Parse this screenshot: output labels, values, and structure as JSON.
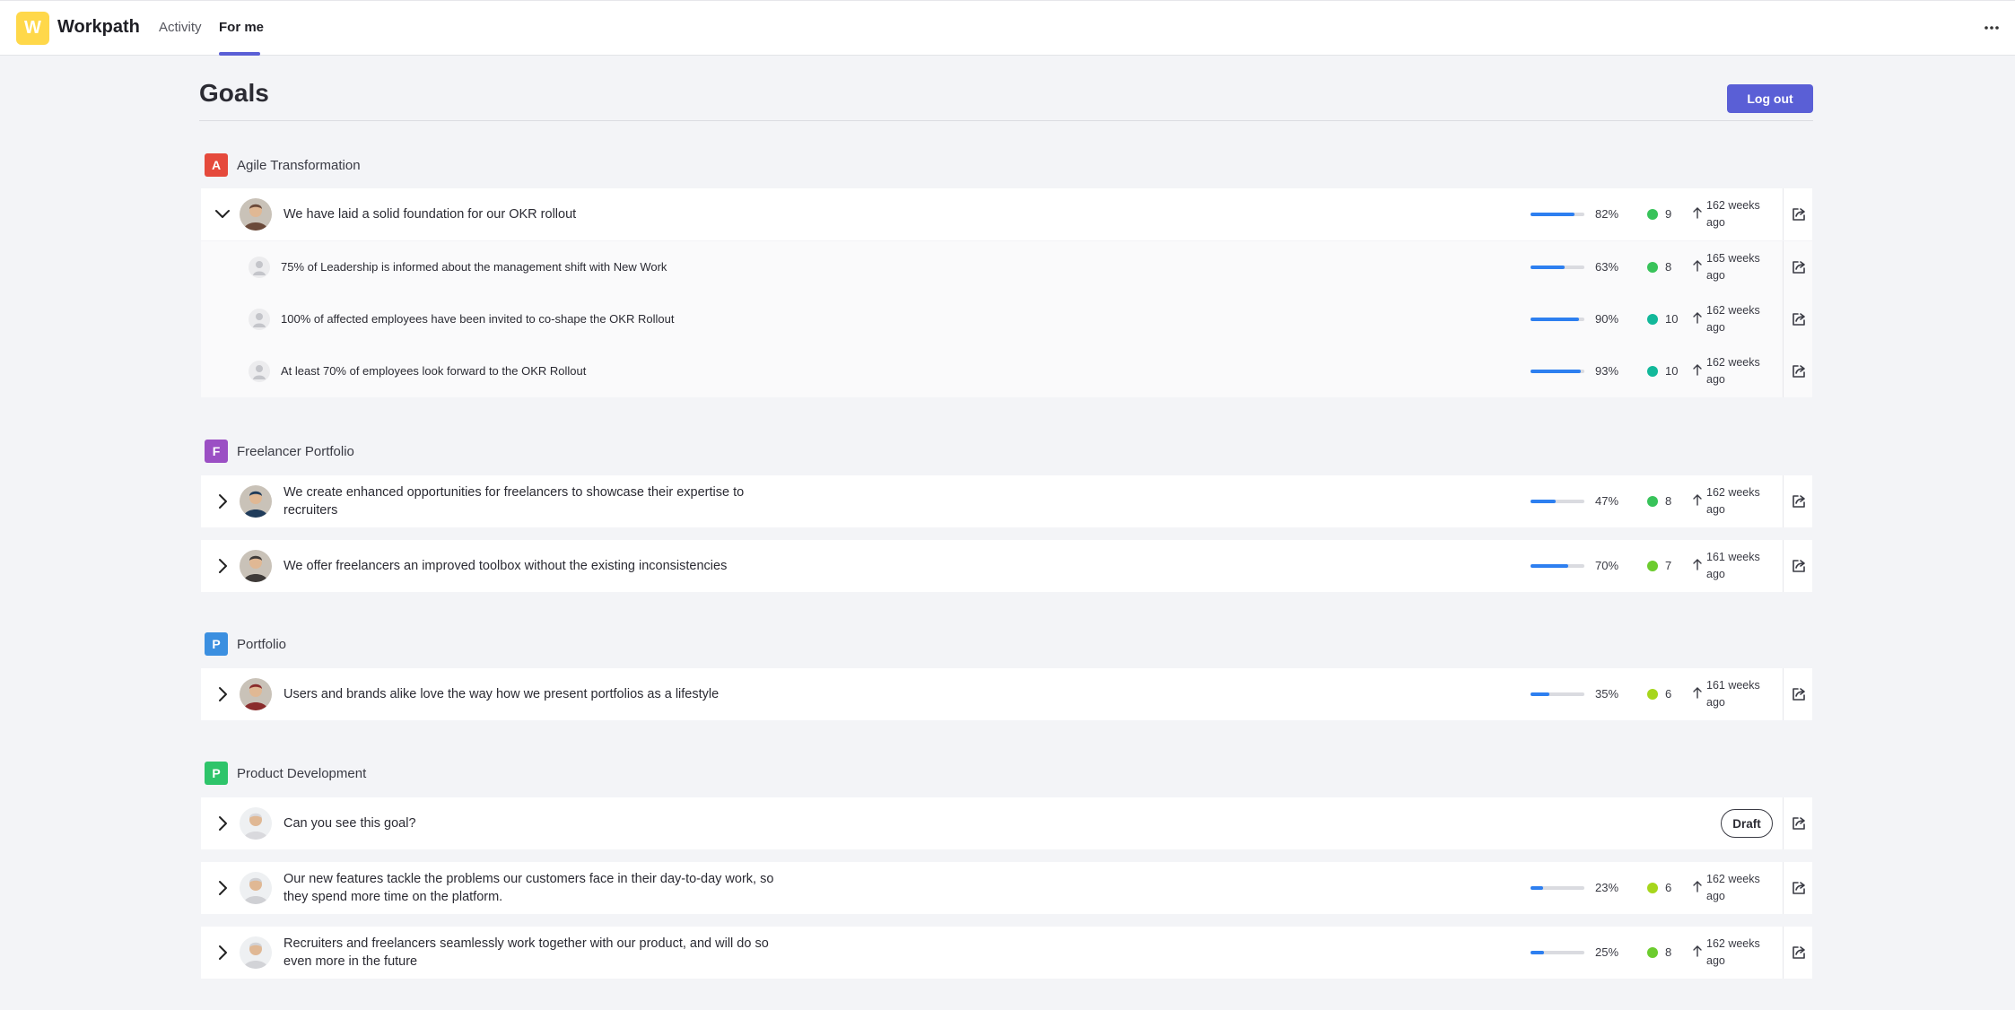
{
  "header": {
    "logo_letter": "W",
    "brand": "Workpath",
    "tabs": [
      {
        "label": "Activity"
      },
      {
        "label": "For me"
      }
    ],
    "more_icon": "ellipsis-icon"
  },
  "page": {
    "title": "Goals",
    "logout_label": "Log out"
  },
  "colors": {
    "accent": "#5a5fd6",
    "progress": "#2d7ff0",
    "status_green": "#38c35a",
    "status_teal": "#12b89a",
    "status_lime": "#a6d61c"
  },
  "groups": [
    {
      "badge": "A",
      "badge_color": "#e54a3c",
      "name": "Agile Transformation",
      "rows": [
        {
          "title": "We have laid a solid foundation for our OKR rollout",
          "progress": 0.82,
          "pct": "82%",
          "score": "9",
          "dot": "#38c35a",
          "updated": "162 weeks ago",
          "expanded": true
        },
        {
          "title": "75% of Leadership is informed about the management shift with New Work",
          "progress": 0.63,
          "pct": "63%",
          "score": "8",
          "dot": "#38c35a",
          "updated": "165 weeks ago",
          "sub": true
        },
        {
          "title": "100% of affected employees have been invited to co-shape the OKR Rollout",
          "progress": 0.9,
          "pct": "90%",
          "score": "10",
          "dot": "#12b89a",
          "updated": "162 weeks ago",
          "sub": true
        },
        {
          "title": "At least 70% of employees look forward to the OKR Rollout",
          "progress": 0.93,
          "pct": "93%",
          "score": "10",
          "dot": "#12b89a",
          "updated": "162 weeks ago",
          "sub": true
        }
      ]
    },
    {
      "badge": "F",
      "badge_color": "#9b4fc4",
      "name": "Freelancer Portfolio",
      "rows": [
        {
          "title": "We create enhanced opportunities for freelancers to showcase their expertise to recruiters",
          "progress": 0.47,
          "pct": "47%",
          "score": "8",
          "dot": "#38c35a",
          "updated": "162 weeks ago"
        },
        {
          "title": "We offer freelancers an improved toolbox without the existing inconsistencies",
          "progress": 0.7,
          "pct": "70%",
          "score": "7",
          "dot": "#6ccc2e",
          "updated": "161 weeks ago"
        }
      ]
    },
    {
      "badge": "P",
      "badge_color": "#3b8fe0",
      "name": "Portfolio",
      "rows": [
        {
          "title": "Users and brands alike love the way how we present portfolios as a lifestyle",
          "progress": 0.35,
          "pct": "35%",
          "score": "6",
          "dot": "#a6d61c",
          "updated": "161 weeks ago"
        }
      ]
    },
    {
      "badge": "P",
      "badge_color": "#2ec46a",
      "name": "Product Development",
      "rows": [
        {
          "title": "Can you see this goal?",
          "draft": "Draft"
        },
        {
          "title": "Our new features tackle the problems our customers face in their day-to-day work, so they spend more time on the platform.",
          "progress": 0.23,
          "pct": "23%",
          "score": "6",
          "dot": "#a6d61c",
          "updated": "162 weeks ago"
        },
        {
          "title": "Recruiters and freelancers seamlessly work together with our product, and will do so even more in the future",
          "progress": 0.25,
          "pct": "25%",
          "score": "8",
          "dot": "#6ccc2e",
          "updated": "162 weeks ago"
        }
      ]
    }
  ]
}
